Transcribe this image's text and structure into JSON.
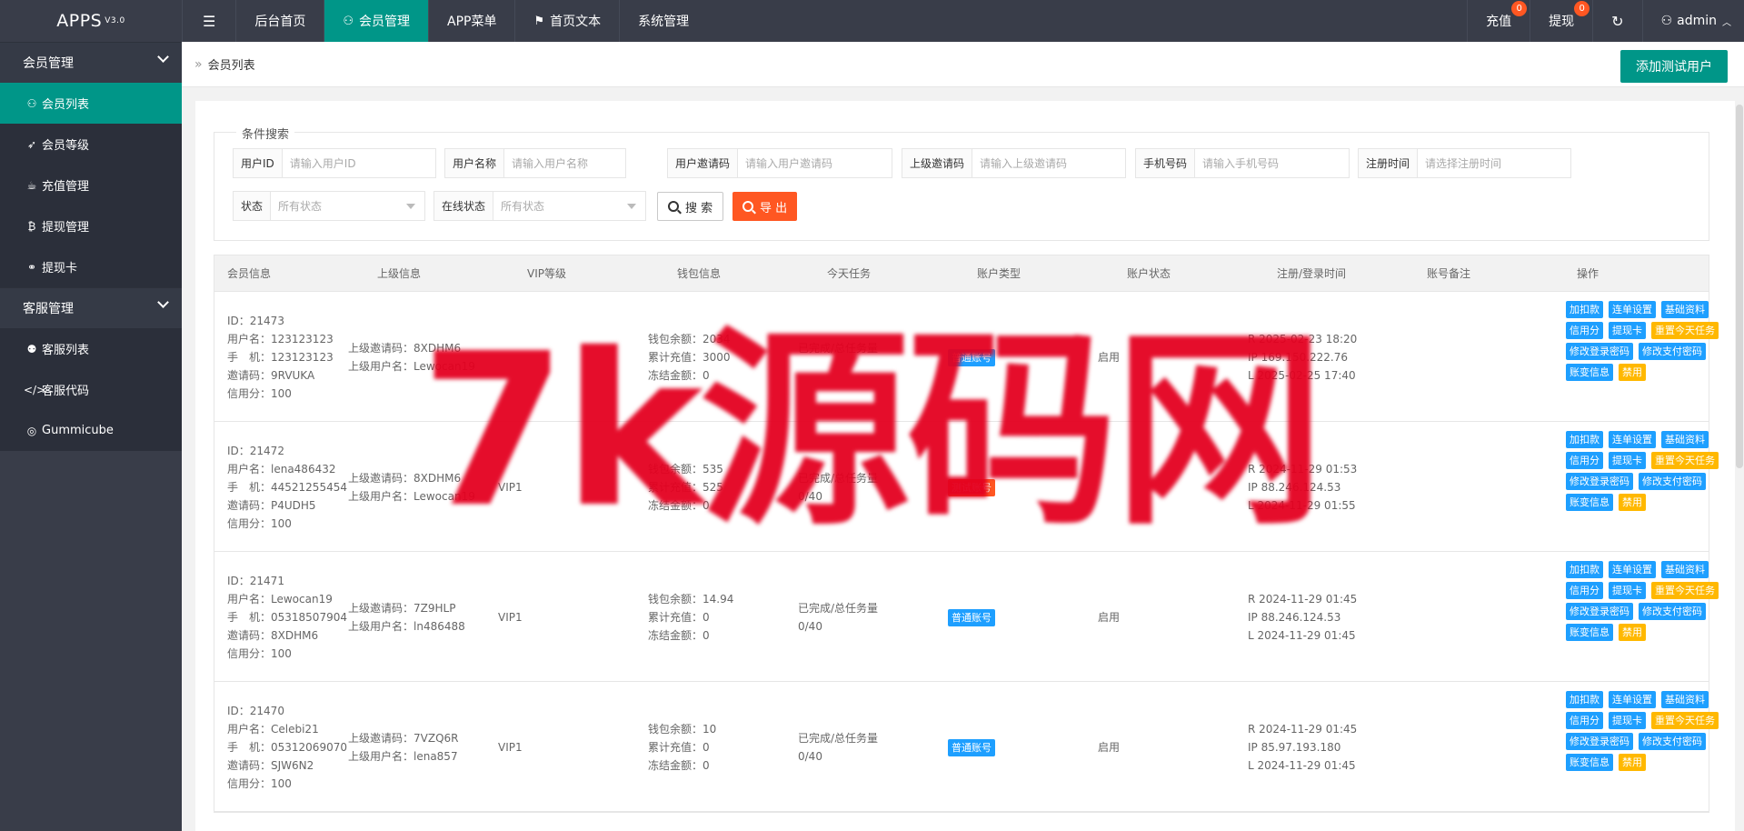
{
  "app": {
    "name": "APPS",
    "version": "V3.0"
  },
  "topnav": [
    {
      "label": "后台首页",
      "icon": ""
    },
    {
      "label": "会员管理",
      "icon": "user-icon",
      "active": true
    },
    {
      "label": "APP菜单",
      "icon": ""
    },
    {
      "label": "首页文本",
      "icon": "flag-icon"
    },
    {
      "label": "系统管理",
      "icon": ""
    }
  ],
  "topright": {
    "recharge": {
      "label": "充值",
      "count": "0"
    },
    "withdraw": {
      "label": "提现",
      "count": "0"
    },
    "user": "admin"
  },
  "sidebar": {
    "group1": "会员管理",
    "group1_items": [
      "会员列表",
      "会员等级",
      "充值管理",
      "提现管理",
      "提现卡"
    ],
    "group2": "客服管理",
    "group2_items": [
      "客服列表",
      "客服代码",
      "Gummicube"
    ]
  },
  "breadcrumb": "会员列表",
  "add_button": "添加测试用户",
  "search": {
    "legend": "条件搜索",
    "fields": [
      {
        "label": "用户ID",
        "placeholder": "请输入用户ID"
      },
      {
        "label": "用户名称",
        "placeholder": "请输入用户名称"
      },
      {
        "label": "用户邀请码",
        "placeholder": "请输入用户邀请码"
      },
      {
        "label": "上级邀请码",
        "placeholder": "请输入上级邀请码"
      },
      {
        "label": "手机号码",
        "placeholder": "请输入手机号码"
      },
      {
        "label": "注册时间",
        "placeholder": "请选择注册时间"
      }
    ],
    "status": {
      "label": "状态",
      "value": "所有状态"
    },
    "online": {
      "label": "在线状态",
      "value": "所有状态"
    },
    "search_btn": "搜 索",
    "export_btn": "导 出"
  },
  "table": {
    "headers": [
      "会员信息",
      "上级信息",
      "VIP等级",
      "钱包信息",
      "今天任务",
      "账户类型",
      "账户状态",
      "注册/登录时间",
      "账号备注",
      "操作"
    ],
    "ops": [
      "加扣款",
      "连单设置",
      "基础资料",
      "信用分",
      "提现卡",
      "重置今天任务",
      "修改登录密码",
      "修改支付密码",
      "账变信息",
      "禁用"
    ],
    "rows": [
      {
        "member": [
          "ID：21473",
          "用户名：123123123",
          "手　机：123123123",
          "邀请码：9RVUKA",
          "信用分：100"
        ],
        "parent": [
          "上级邀请码：8XDHM6",
          "上级用户名：Lewocan19"
        ],
        "vip": "",
        "wallet": [
          "钱包余额：2034",
          "累计充值：3000",
          "冻结金额：0"
        ],
        "task": [
          "已完成/总任务量",
          ""
        ],
        "type": "普通账号",
        "status": "启用",
        "time": [
          "R 2025-02-23 18:20",
          "IP 169.150.222.76",
          "L 2025-02-25 17:40"
        ]
      },
      {
        "member": [
          "ID：21472",
          "用户名：lena486432",
          "手　机：44521255454",
          "邀请码：P4UDH5",
          "信用分：100"
        ],
        "parent": [
          "上级邀请码：8XDHM6",
          "上级用户名：Lewocan19"
        ],
        "vip": "VIP1",
        "wallet": [
          "钱包余额：535",
          "累计充值：525",
          "冻结金额：0"
        ],
        "task": [
          "已完成/总任务量",
          "0/40"
        ],
        "type": "测试账号",
        "status": "",
        "time": [
          "R 2024-11-29 01:53",
          "IP 88.246.124.53",
          "L 2024-11-29 01:55"
        ]
      },
      {
        "member": [
          "ID：21471",
          "用户名：Lewocan19",
          "手　机：05318507904",
          "邀请码：8XDHM6",
          "信用分：100"
        ],
        "parent": [
          "上级邀请码：7Z9HLP",
          "上级用户名：ln486488"
        ],
        "vip": "VIP1",
        "wallet": [
          "钱包余额：14.94",
          "累计充值：0",
          "冻结金额：0"
        ],
        "task": [
          "已完成/总任务量",
          "0/40"
        ],
        "type": "普通账号",
        "status": "启用",
        "time": [
          "R 2024-11-29 01:45",
          "IP 88.246.124.53",
          "L 2024-11-29 01:45"
        ]
      },
      {
        "member": [
          "ID：21470",
          "用户名：Celebi21",
          "手　机：05312069070",
          "邀请码：SJW6N2",
          "信用分：100"
        ],
        "parent": [
          "上级邀请码：7VZQ6R",
          "上级用户名：lena857"
        ],
        "vip": "VIP1",
        "wallet": [
          "钱包余额：10",
          "累计充值：0",
          "冻结金额：0"
        ],
        "task": [
          "已完成/总任务量",
          "0/40"
        ],
        "type": "普通账号",
        "status": "启用",
        "time": [
          "R 2024-11-29 01:45",
          "IP 85.97.193.180",
          "L 2024-11-29 01:45"
        ]
      }
    ]
  },
  "colors": {
    "primary": "#009688",
    "normal": "#1e9fff",
    "warn": "#ffb800",
    "danger": "#ff5722",
    "dark": "#393d49"
  },
  "watermark": "7k源码网"
}
